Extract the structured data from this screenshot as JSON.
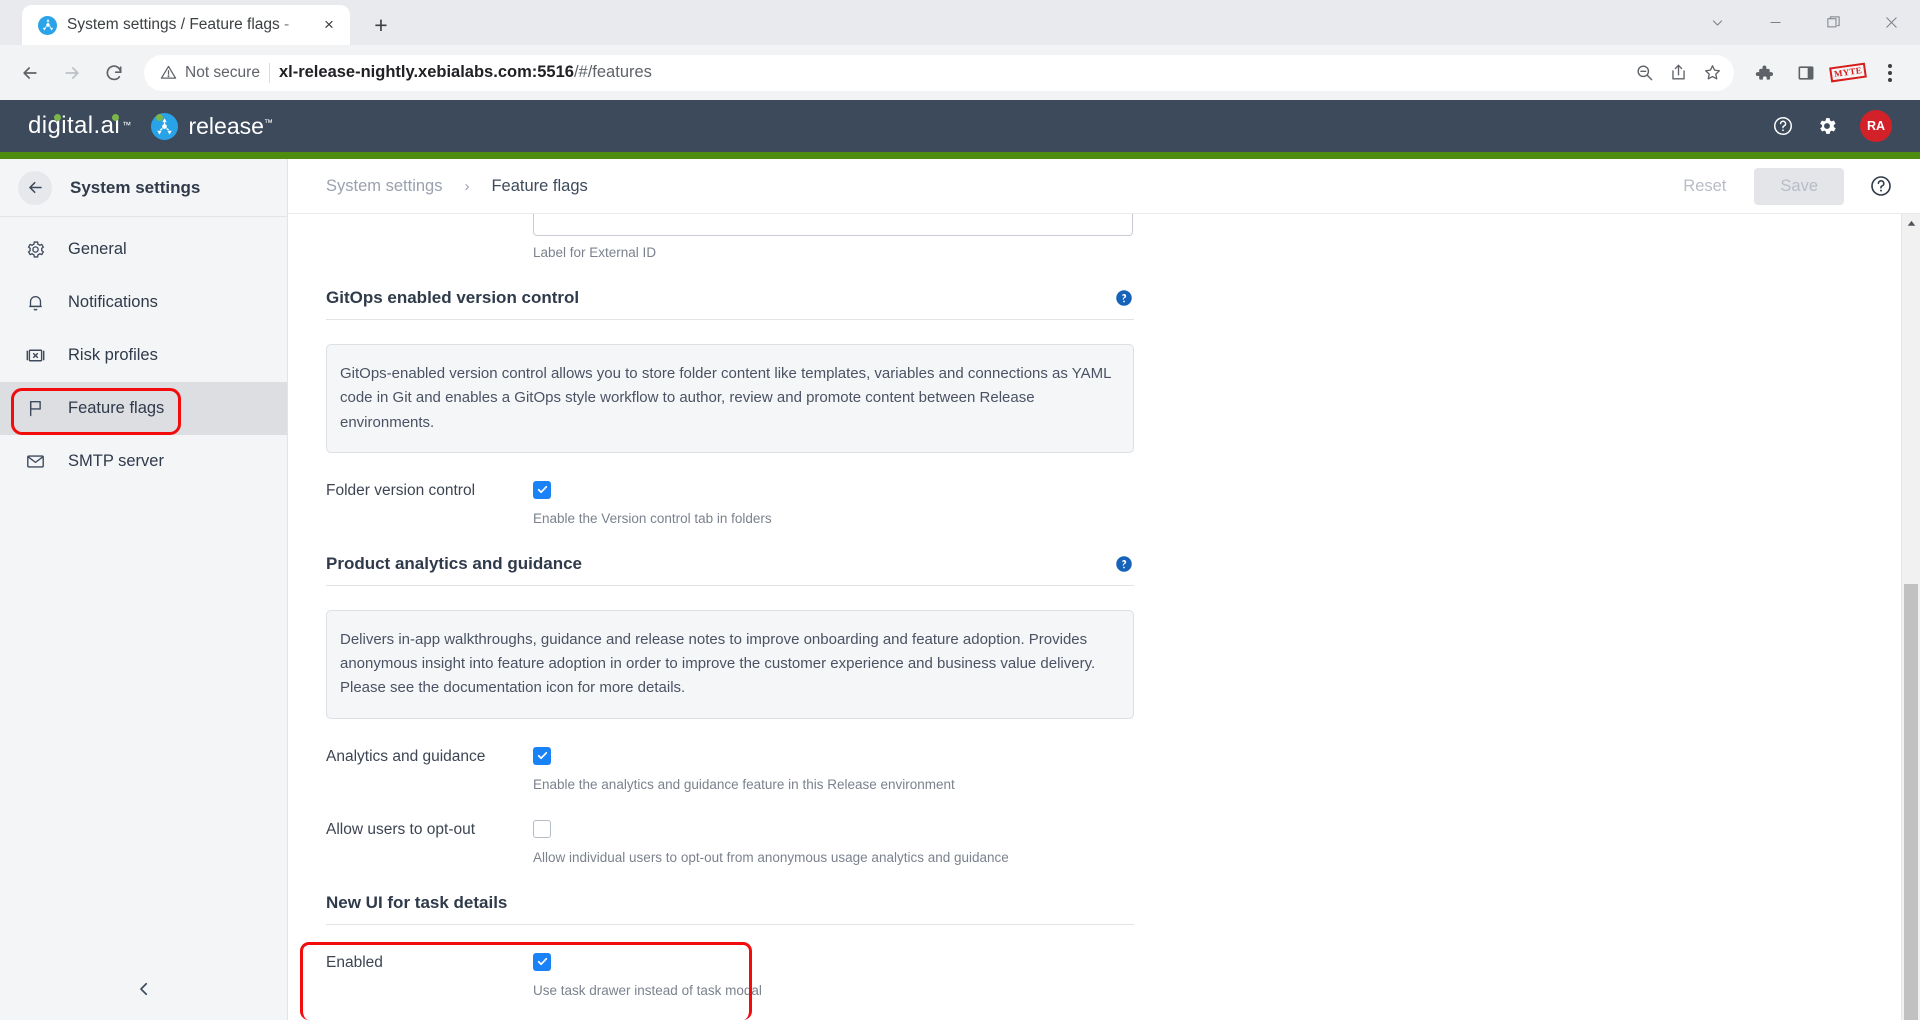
{
  "browser": {
    "tab": {
      "title": "System settings / Feature flags - ",
      "favicon": "release-logo-icon",
      "close": "×"
    },
    "new_tab_label": "+",
    "window_controls": [
      "tab-search-chevron-icon",
      "minimize-icon",
      "maximize-icon",
      "close-icon"
    ],
    "nav": {
      "back": "back-arrow-icon",
      "forward": "forward-arrow-icon",
      "reload": "reload-icon"
    },
    "security_label": "Not secure",
    "url": {
      "host": "xl-release-nightly.xebialabs.com:5516",
      "path": "/#/features"
    },
    "omnibox_actions": [
      "zoom-out-icon",
      "share-icon",
      "bookmark-star-icon"
    ],
    "toolbar_actions": [
      "extensions-puzzle-icon",
      "side-panel-icon"
    ],
    "extension_stamp_label": "MYTE",
    "menu": "three-dot-menu-icon"
  },
  "app": {
    "brand_primary": "digital.ai",
    "brand_secondary": "release",
    "trademark": "™",
    "header_icons": [
      "help-circle-icon",
      "settings-gear-icon"
    ],
    "avatar_initials": "RA",
    "colors": {
      "header_bg": "#3d4a5c",
      "accent_green": "#4e8c10",
      "avatar_red": "#d32129",
      "checkbox_blue": "#1a82f7",
      "annotation_red": "#f20c0c",
      "link_blue": "#1663ba"
    }
  },
  "sidebar": {
    "header": {
      "back_icon": "back-arrow-icon",
      "title": "System settings"
    },
    "items": [
      {
        "label": "General",
        "icon": "gear-icon",
        "active": false
      },
      {
        "label": "Notifications",
        "icon": "bell-icon",
        "active": false
      },
      {
        "label": "Risk profiles",
        "icon": "risk-profile-icon",
        "active": false
      },
      {
        "label": "Feature flags",
        "icon": "flag-icon",
        "active": true
      },
      {
        "label": "SMTP server",
        "icon": "envelope-icon",
        "active": false
      }
    ],
    "collapse_icon": "chevron-left-icon"
  },
  "toolbar": {
    "breadcrumb_parent": "System settings",
    "breadcrumb_separator": "›",
    "breadcrumb_current": "Feature flags",
    "reset_label": "Reset",
    "save_label": "Save",
    "help_icon": "help-circle-icon"
  },
  "main": {
    "external_id_helper": "Label for External ID",
    "sections": [
      {
        "title": "GitOps enabled version control",
        "help_icon": "help-circle-icon",
        "description": "GitOps-enabled version control allows you to store folder content like templates, variables and connections as YAML code in Git and enables a GitOps style workflow to author, review and promote content between Release environments.",
        "fields": [
          {
            "label": "Folder version control",
            "checked": true,
            "helper": "Enable the Version control tab in folders"
          }
        ]
      },
      {
        "title": "Product analytics and guidance",
        "help_icon": "help-circle-icon",
        "description": "Delivers in-app walkthroughs, guidance and release notes to improve onboarding and feature adoption. Provides anonymous insight into feature adoption in order to improve the customer experience and business value delivery. Please see the documentation icon for more details.",
        "fields": [
          {
            "label": "Analytics and guidance",
            "checked": true,
            "helper": "Enable the analytics and guidance feature in this Release environment"
          },
          {
            "label": "Allow users to opt-out",
            "checked": false,
            "helper": "Allow individual users to opt-out from anonymous usage analytics and guidance"
          }
        ]
      },
      {
        "title": "New UI for task details",
        "help_icon": null,
        "description": null,
        "fields": [
          {
            "label": "Enabled",
            "checked": true,
            "helper": "Use task drawer instead of task modal"
          }
        ]
      }
    ]
  },
  "scrollbar": {
    "up_arrow": "scroll-up-arrow-icon"
  }
}
